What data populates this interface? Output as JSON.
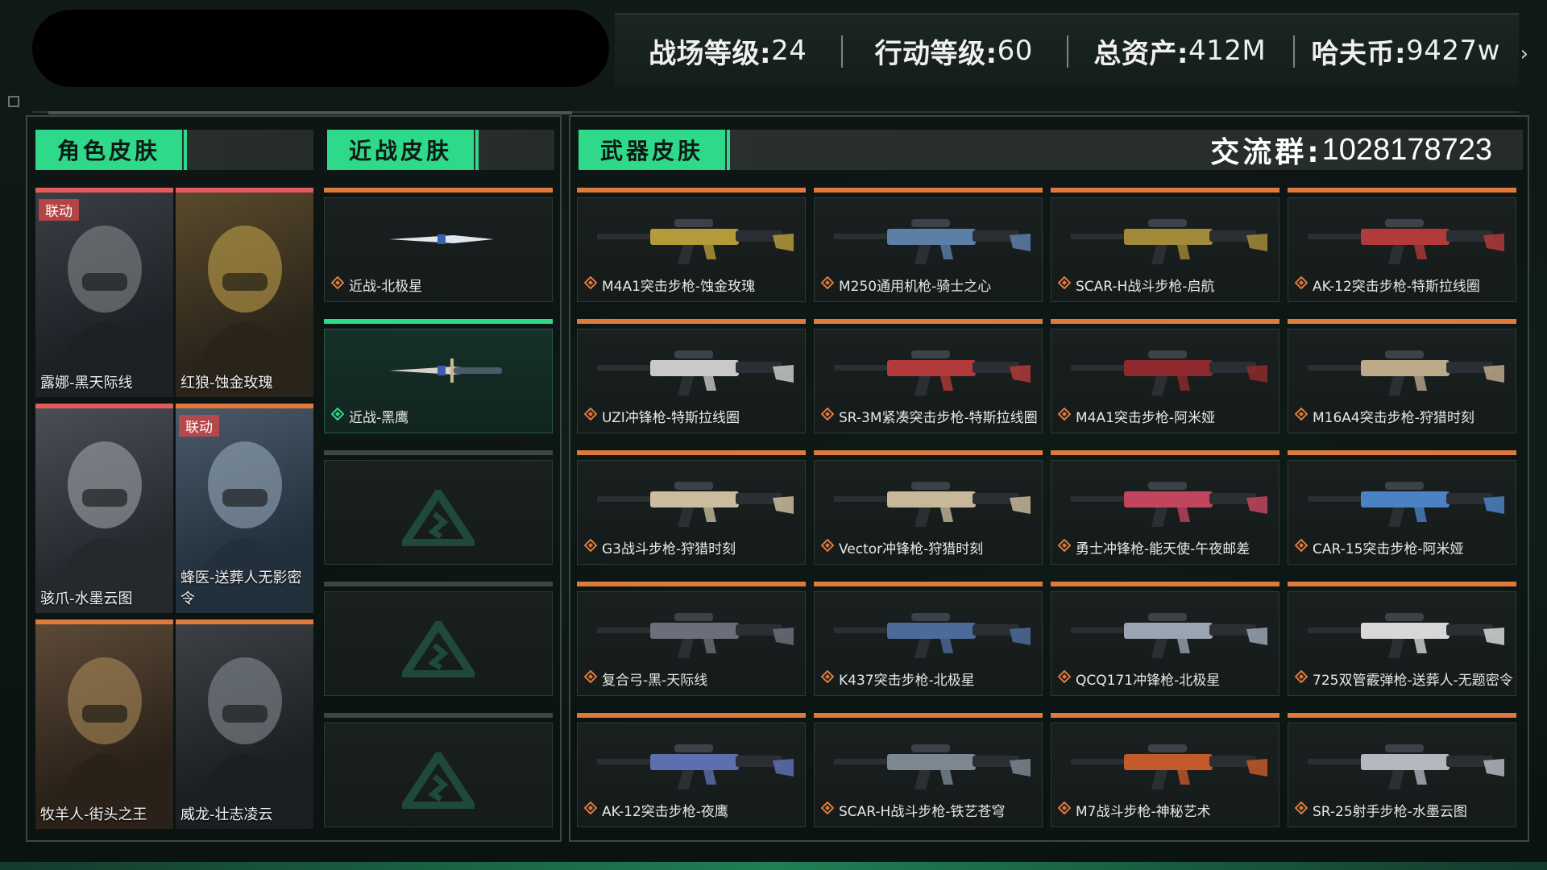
{
  "header": {
    "stats": [
      {
        "label": "战场等级:",
        "value": "24"
      },
      {
        "label": "行动等级:",
        "value": "60"
      },
      {
        "label": "总资产:",
        "value": "412M"
      },
      {
        "label": "哈夫币:",
        "value": "9427w"
      }
    ]
  },
  "tabs": {
    "character": "角色皮肤",
    "melee": "近战皮肤",
    "weapon": "武器皮肤"
  },
  "group": {
    "label": "交流群:",
    "value": "1028178723"
  },
  "characters": [
    {
      "name": "露娜-黑天际线",
      "badge": "联动",
      "color": "#e35b5b"
    },
    {
      "name": "红狼-蚀金玫瑰",
      "badge": "",
      "color": "#e35b5b"
    },
    {
      "name": "骇爪-水墨云图",
      "badge": "",
      "color": "#e35b5b"
    },
    {
      "name": "蜂医-送葬人无影密令",
      "badge": "联动",
      "color": "#e07a3c"
    },
    {
      "name": "牧羊人-街头之王",
      "badge": "",
      "color": "#e07a3c"
    },
    {
      "name": "威龙-壮志凌云",
      "badge": "",
      "color": "#e07a3c"
    }
  ],
  "melee": [
    {
      "name": "近战-北极星",
      "rarity": "orange"
    },
    {
      "name": "近战-黑鹰",
      "rarity": "green"
    },
    {
      "name": "",
      "rarity": "grey"
    },
    {
      "name": "",
      "rarity": "grey"
    },
    {
      "name": "",
      "rarity": "grey"
    }
  ],
  "weapons": [
    {
      "name": "M4A1突击步枪-蚀金玫瑰",
      "tint": "#b59a3b"
    },
    {
      "name": "M250通用机枪-骑士之心",
      "tint": "#5c7fa8"
    },
    {
      "name": "SCAR-H战斗步枪-启航",
      "tint": "#a38a3a"
    },
    {
      "name": "AK-12突击步枪-特斯拉线圈",
      "tint": "#b23a3a"
    },
    {
      "name": "UZI冲锋枪-特斯拉线圈",
      "tint": "#c9c9c9"
    },
    {
      "name": "SR-3M紧凑突击步枪-特斯拉线圈",
      "tint": "#b33a3a"
    },
    {
      "name": "M4A1突击步枪-阿米娅",
      "tint": "#8e2a2e"
    },
    {
      "name": "M16A4突击步枪-狩猎时刻",
      "tint": "#bca98a"
    },
    {
      "name": "G3战斗步枪-狩猎时刻",
      "tint": "#cbbd9f"
    },
    {
      "name": "Vector冲锋枪-狩猎时刻",
      "tint": "#c7b89a"
    },
    {
      "name": "勇士冲锋枪-能天使-午夜邮差",
      "tint": "#c2455e"
    },
    {
      "name": "CAR-15突击步枪-阿米娅",
      "tint": "#4b82c3"
    },
    {
      "name": "复合弓-黑-天际线",
      "tint": "#6a6f7a"
    },
    {
      "name": "K437突击步枪-北极星",
      "tint": "#4d6b9a"
    },
    {
      "name": "QCQ171冲锋枪-北极星",
      "tint": "#9aa4b3"
    },
    {
      "name": "725双管霰弹枪-送葬人-无题密令",
      "tint": "#d7d7d7"
    },
    {
      "name": "AK-12突击步枪-夜鹰",
      "tint": "#5e6fb0"
    },
    {
      "name": "SCAR-H战斗步枪-铁艺苍穹",
      "tint": "#7c8791"
    },
    {
      "name": "M7战斗步枪-神秘艺术",
      "tint": "#c25a2c"
    },
    {
      "name": "SR-25射手步枪-水墨云图",
      "tint": "#b3b8bf"
    }
  ]
}
